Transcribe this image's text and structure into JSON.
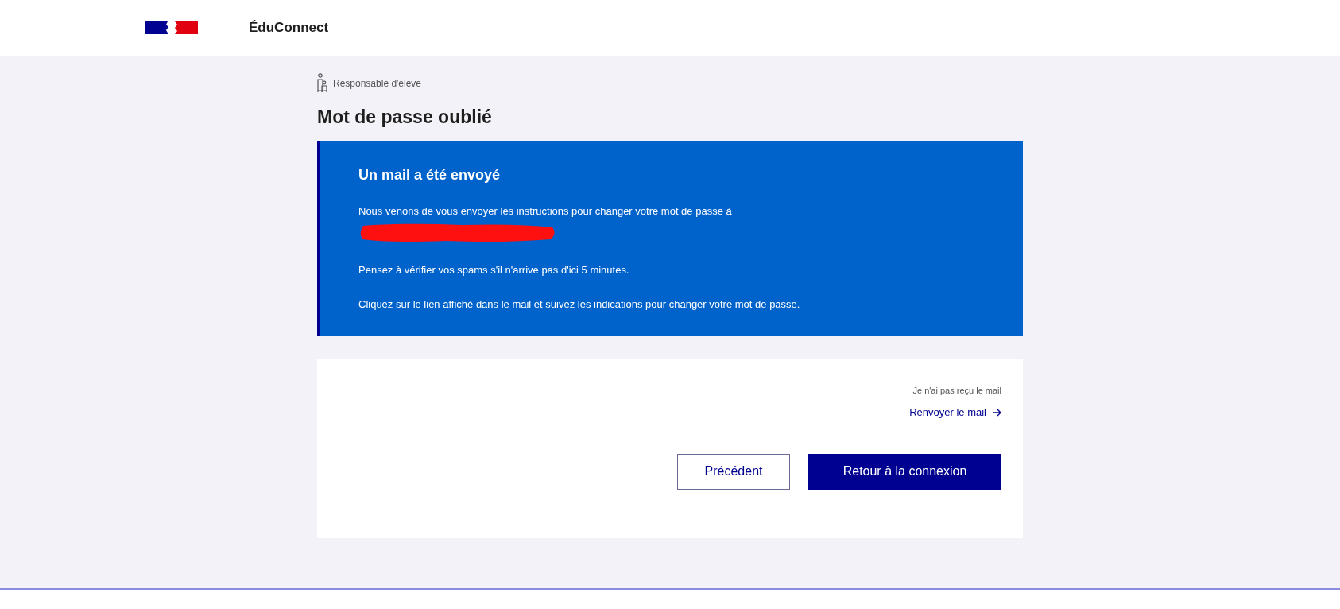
{
  "header": {
    "site_name": "ÉduConnect"
  },
  "profile": {
    "label": "Responsable d'élève"
  },
  "page_title": "Mot de passe oublié",
  "notice": {
    "title": "Un mail a été envoyé",
    "paragraphs": [
      {
        "text": "Nous venons de vous envoyer les instructions pour changer votre mot de passe à",
        "email_redacted": true
      },
      {
        "text": "Pensez à vérifier vos spams s'il n'arrive pas d'ici 5 minutes."
      },
      {
        "text": "Cliquez sur le lien affiché dans le mail et suivez les indications pour changer votre mot de passe."
      }
    ]
  },
  "resend": {
    "hint": "Je n'ai pas reçu le mail",
    "link": "Renvoyer le mail"
  },
  "buttons": [
    {
      "label": "Précédent",
      "kind": "secondary"
    },
    {
      "label": "Retour à la connexion",
      "kind": "primary"
    }
  ]
}
